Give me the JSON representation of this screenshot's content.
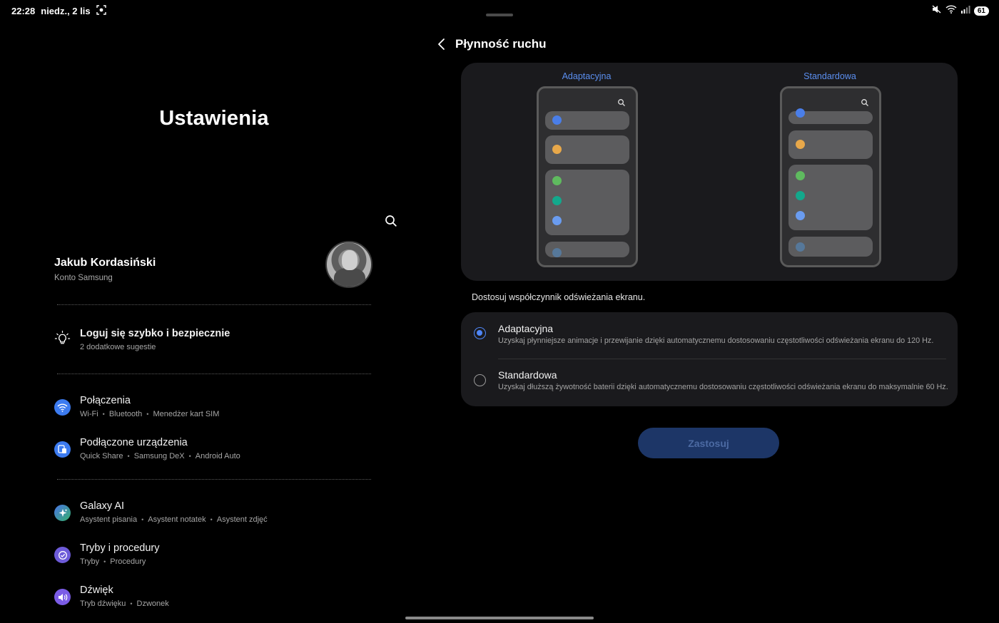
{
  "status_bar": {
    "time": "22:28",
    "date": "niedz., 2 lis",
    "battery": "61"
  },
  "left": {
    "title": "Ustawienia",
    "profile": {
      "name": "Jakub Kordasiński",
      "account": "Konto Samsung"
    },
    "suggestion": {
      "title": "Loguj się szybko i bezpiecznie",
      "sub": "2 dodatkowe sugestie"
    },
    "items": [
      {
        "title": "Połączenia",
        "subs": [
          "Wi-Fi",
          "Bluetooth",
          "Menedżer kart SIM"
        ],
        "color": "#3c7bf0",
        "icon": "wifi-icon"
      },
      {
        "title": "Podłączone urządzenia",
        "subs": [
          "Quick Share",
          "Samsung DeX",
          "Android Auto"
        ],
        "color": "#3c7bf0",
        "icon": "devices-icon"
      },
      {
        "title": "Galaxy AI",
        "subs": [
          "Asystent pisania",
          "Asystent notatek",
          "Asystent zdjęć"
        ],
        "color": "#3b6fe0",
        "icon": "sparkle-icon"
      },
      {
        "title": "Tryby i procedury",
        "subs": [
          "Tryby",
          "Procedury"
        ],
        "color": "#6d5bd9",
        "icon": "modes-icon"
      },
      {
        "title": "Dźwięk",
        "subs": [
          "Tryb dźwięku",
          "Dzwonek"
        ],
        "color": "#7b5ce6",
        "icon": "sound-icon"
      }
    ]
  },
  "right": {
    "title": "Płynność ruchu",
    "preview": {
      "left_label": "Adaptacyjna",
      "right_label": "Standardowa"
    },
    "subtitle": "Dostosuj współczynnik odświeżania ekranu.",
    "options": [
      {
        "title": "Adaptacyjna",
        "desc": "Uzyskaj płynniejsze animacje i przewijanie dzięki automatycznemu dostosowaniu częstotliwości odświeżania ekranu do 120 Hz.",
        "selected": true
      },
      {
        "title": "Standardowa",
        "desc": "Uzyskaj dłuższą żywotność baterii dzięki automatycznemu dostosowaniu częstotliwości odświeżania ekranu do maksymalnie 60 Hz.",
        "selected": false
      }
    ],
    "apply_label": "Zastosuj"
  },
  "colors": {
    "accent": "#4f86f7",
    "dot_blue": "#4a7ee8",
    "dot_orange": "#e8a84a",
    "dot_green": "#5fba5f",
    "dot_teal": "#13a88c",
    "dot_lightblue": "#6a9cf0"
  }
}
